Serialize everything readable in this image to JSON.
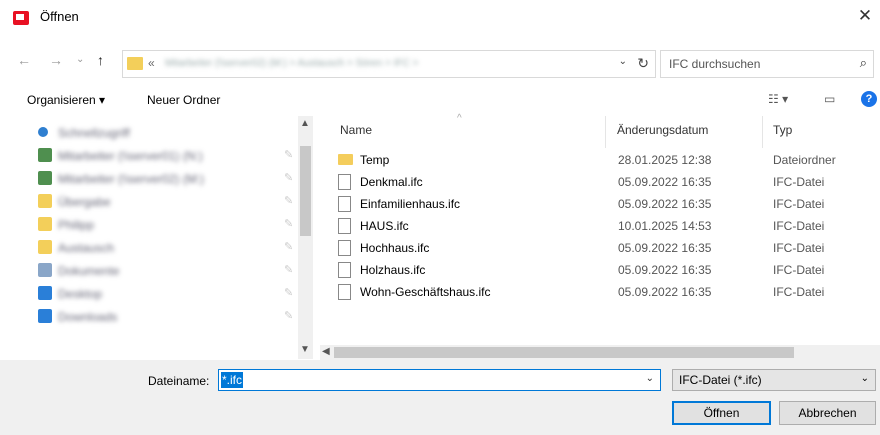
{
  "window": {
    "title": "Öffnen",
    "close_glyph": "✕"
  },
  "nav": {
    "back": "←",
    "forward": "→",
    "dropdown": "⌄",
    "up": "↑"
  },
  "address": {
    "chevron": "«",
    "crumbs": "Mitarbeiter (\\\\server02) (M:) > Austausch > Sören > IFC >",
    "dropdown": "⌄",
    "refresh": "↻"
  },
  "search": {
    "placeholder": "IFC durchsuchen",
    "icon": "search-icon"
  },
  "toolbar": {
    "organize": "Organisieren ▾",
    "new_folder": "Neuer Ordner",
    "help": "?"
  },
  "navpane": {
    "items": [
      {
        "label": "Schnellzugriff",
        "color": "#2f7fd0"
      },
      {
        "label": "Mitarbeiter (\\\\server01) (N:)",
        "color": "#4f8f4f"
      },
      {
        "label": "Mitarbeiter (\\\\server02) (M:)",
        "color": "#4f8f4f"
      },
      {
        "label": "Übergabe",
        "color": "#f3cf5a"
      },
      {
        "label": "Philipp",
        "color": "#f3cf5a"
      },
      {
        "label": "Austausch",
        "color": "#f3cf5a"
      },
      {
        "label": "Dokumente",
        "color": "#8aa6c8"
      },
      {
        "label": "Desktop",
        "color": "#2a7fd8"
      },
      {
        "label": "Downloads",
        "color": "#2a7fd8"
      }
    ]
  },
  "columns": {
    "name": "Name",
    "date": "Änderungsdatum",
    "type": "Typ"
  },
  "files": [
    {
      "name": "Temp",
      "date": "28.01.2025 12:38",
      "type": "Dateiordner",
      "kind": "folder"
    },
    {
      "name": "Denkmal.ifc",
      "date": "05.09.2022 16:35",
      "type": "IFC-Datei",
      "kind": "file"
    },
    {
      "name": "Einfamilienhaus.ifc",
      "date": "05.09.2022 16:35",
      "type": "IFC-Datei",
      "kind": "file"
    },
    {
      "name": "HAUS.ifc",
      "date": "10.01.2025 14:53",
      "type": "IFC-Datei",
      "kind": "file"
    },
    {
      "name": "Hochhaus.ifc",
      "date": "05.09.2022 16:35",
      "type": "IFC-Datei",
      "kind": "file"
    },
    {
      "name": "Holzhaus.ifc",
      "date": "05.09.2022 16:35",
      "type": "IFC-Datei",
      "kind": "file"
    },
    {
      "name": "Wohn-Geschäftshaus.ifc",
      "date": "05.09.2022 16:35",
      "type": "IFC-Datei",
      "kind": "file"
    }
  ],
  "footer": {
    "filename_label": "Dateiname:",
    "filename_value": "*.ifc",
    "filetype_value": "IFC-Datei (*.ifc)",
    "open_label": "Öffnen",
    "cancel_label": "Abbrechen"
  }
}
